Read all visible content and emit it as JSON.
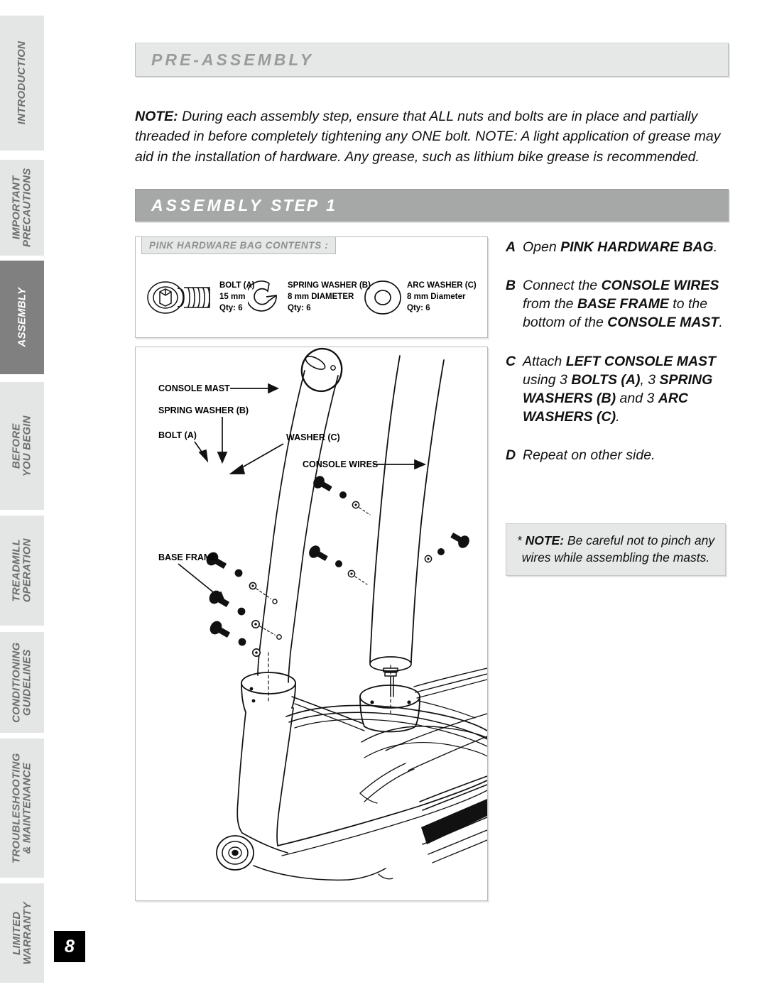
{
  "sidebar": {
    "tabs": [
      {
        "label": "INTRODUCTION",
        "active": false
      },
      {
        "label": "IMPORTANT\nPRECAUTIONS",
        "active": false
      },
      {
        "label": "ASSEMBLY",
        "active": true
      },
      {
        "label": "BEFORE\nYOU BEGIN",
        "active": false
      },
      {
        "label": "TREADMILL\nOPERATION",
        "active": false
      },
      {
        "label": "CONDITIONING\nGUIDELINES",
        "active": false
      },
      {
        "label": "TROUBLESHOOTING\n& MAINTENANCE",
        "active": false
      },
      {
        "label": "LIMITED\nWARRANTY",
        "active": false
      }
    ]
  },
  "page_number": "8",
  "banners": {
    "pre_assembly": "PRE-ASSEMBLY",
    "assembly_step_word": "ASSEMBLY",
    "assembly_step_label": "STEP",
    "assembly_step_number": "1"
  },
  "pre_note": {
    "lead": "NOTE:",
    "body": " During each assembly step, ensure that ALL nuts and bolts are in place and partially threaded in before completely tightening any ONE bolt. NOTE: A light application of grease may aid in the installation of hardware. Any grease, such as lithium bike grease is recommended."
  },
  "hardware_bag": {
    "header": "PINK HARDWARE BAG CONTENTS :",
    "items": [
      {
        "icon": "bolt-icon",
        "name": "BOLT (A)",
        "spec": "15 mm",
        "qty": "Qty: 6"
      },
      {
        "icon": "spring-washer-icon",
        "name": "SPRING WASHER (B)",
        "spec": "8 mm DIAMETER",
        "qty": "Qty: 6"
      },
      {
        "icon": "arc-washer-icon",
        "name": "ARC WASHER (C)",
        "spec": "8 mm Diameter",
        "qty": "Qty: 6"
      }
    ]
  },
  "steps": [
    {
      "letter": "A",
      "text_html": "Open <b>PINK HARDWARE BAG</b>."
    },
    {
      "letter": "B",
      "text_html": "Connect the <b>CONSOLE WIRES</b> from the <b>BASE FRAME</b> to the bottom of the <b>CONSOLE MAST</b>."
    },
    {
      "letter": "C",
      "text_html": "Attach <b>LEFT CONSOLE MAST</b> using 3 <b>BOLTS (A)</b>, 3 <b>SPRING WASHERS (B)</b> and 3 <b>ARC WASHERS (C)</b>."
    },
    {
      "letter": "D",
      "text_html": "Repeat on other side."
    }
  ],
  "side_note": {
    "html": "* <b>NOTE:</b> Be careful not to pinch any wires while assembling the masts."
  },
  "illustration": {
    "labels": [
      {
        "name": "console-mast",
        "text": "CONSOLE MAST"
      },
      {
        "name": "spring-washer-b",
        "text": "SPRING WASHER (B)"
      },
      {
        "name": "bolt-a",
        "text": "BOLT (A)"
      },
      {
        "name": "washer-c",
        "text": "WASHER (C)"
      },
      {
        "name": "console-wires",
        "text": "CONSOLE WIRES"
      },
      {
        "name": "base-frame",
        "text": "BASE FRAME"
      }
    ]
  },
  "colors": {
    "tab_inactive_bg": "#e4e5e5",
    "tab_active_bg": "#808080",
    "tab_inactive_text": "#6d6e6e",
    "banner_pre_bg": "#e6e7e7",
    "banner_step_bg": "#a6a8a8",
    "page_number_bg": "#000000",
    "border": "#b9bcbc"
  }
}
